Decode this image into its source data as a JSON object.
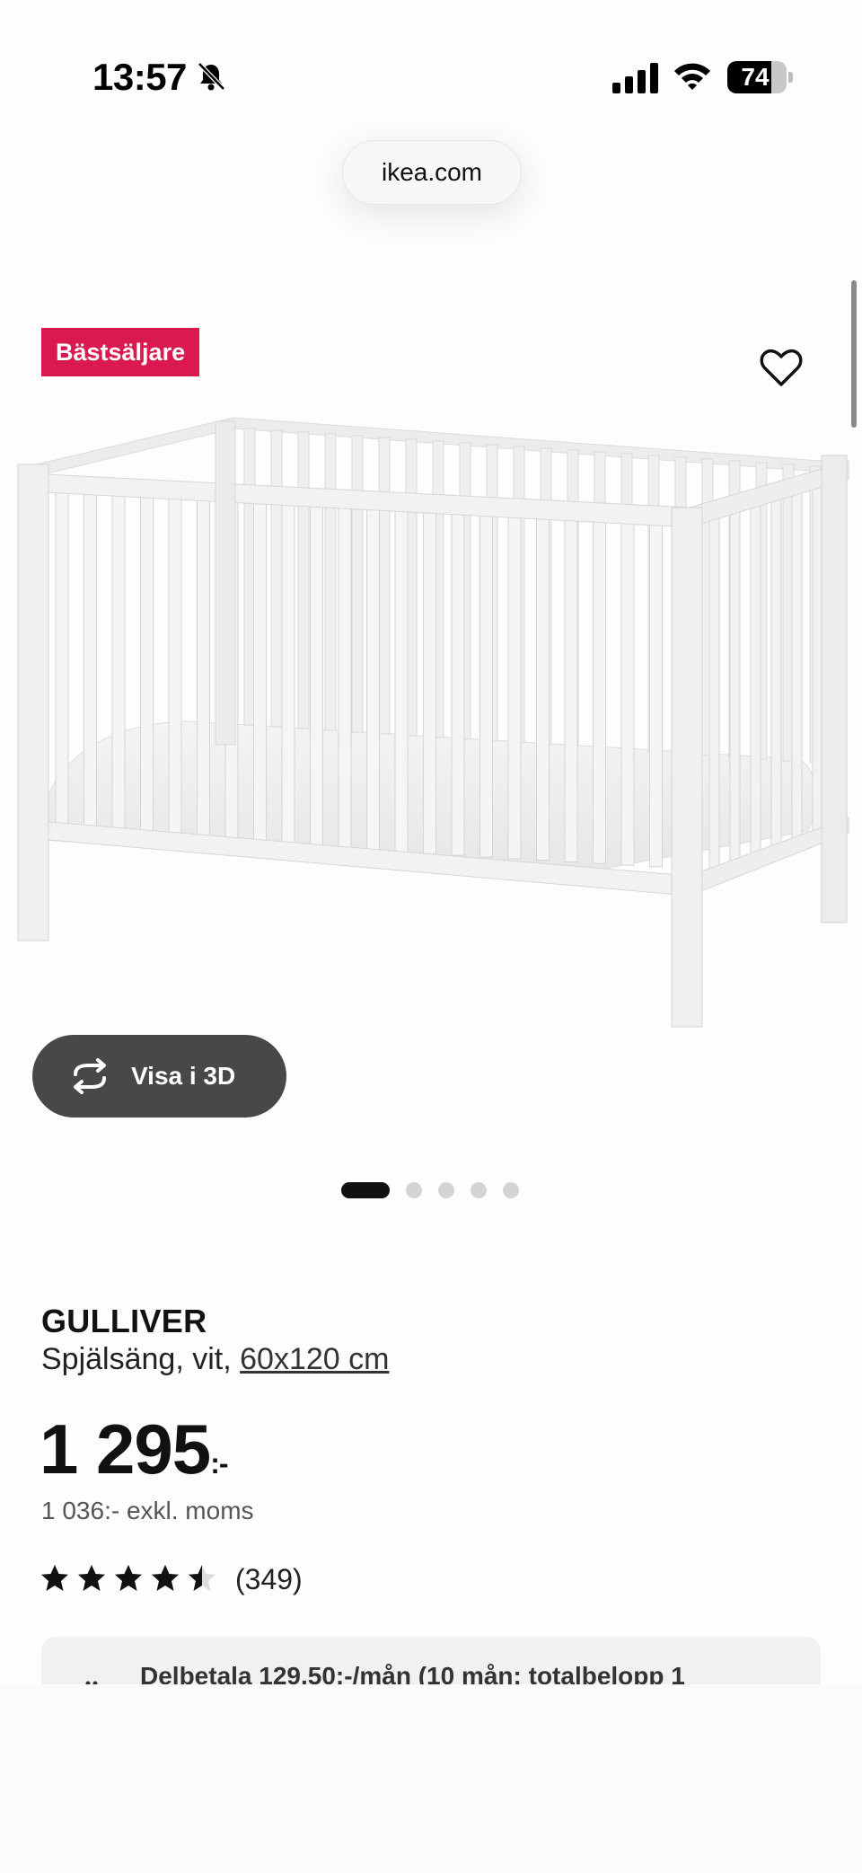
{
  "status_bar": {
    "time": "13:57",
    "battery_percent": "74",
    "battery_level": 0.74
  },
  "browser": {
    "url": "ikea.com"
  },
  "product": {
    "badge": "Bästsäljare",
    "view_3d_label": "Visa i 3D",
    "carousel": {
      "count": 5,
      "active_index": 0
    },
    "name": "GULLIVER",
    "description_prefix": "Spjälsäng, vit,",
    "size_link": "60x120 cm",
    "price_main": "1 295",
    "price_suffix": ":-",
    "price_ex_vat": "1 036:- exkl. moms",
    "rating_value": 4.5,
    "rating_max": 5,
    "review_count": "(349)",
    "installment_text": "Delbetala 129,50:-/mån (10 mån: totalbelopp 1"
  },
  "colors": {
    "badge_bg": "#d9194f",
    "button_dark": "#484848",
    "text": "#111111"
  },
  "icons": [
    "bell-slash-icon",
    "cellular-signal-icon",
    "wifi-icon",
    "battery-icon",
    "heart-icon",
    "rotate-3d-icon",
    "star-icon"
  ]
}
